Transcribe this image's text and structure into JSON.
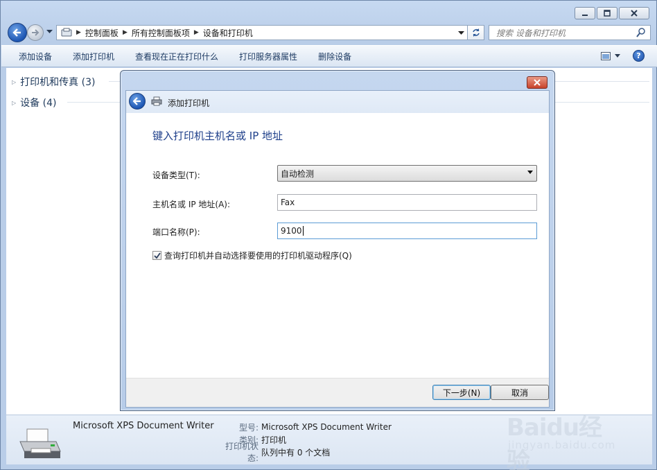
{
  "window": {
    "breadcrumbs": [
      "控制面板",
      "所有控制面板项",
      "设备和打印机"
    ],
    "search_placeholder": "搜索 设备和打印机"
  },
  "toolbar": {
    "items": [
      "添加设备",
      "添加打印机",
      "查看现在正在打印什么",
      "打印服务器属性",
      "删除设备"
    ]
  },
  "groups": [
    {
      "label": "打印机和传真 (3)"
    },
    {
      "label": "设备 (4)"
    }
  ],
  "details": {
    "name": "Microsoft XPS Document Writer",
    "rows": [
      {
        "key": "型号:",
        "value": "Microsoft XPS Document Writer"
      },
      {
        "key": "类别:",
        "value": "打印机"
      },
      {
        "key": "打印机状态:",
        "value": "队列中有 0 个文档"
      }
    ]
  },
  "dialog": {
    "title": "添加打印机",
    "heading": "键入打印机主机名或 IP 地址",
    "device_type_label": "设备类型(T):",
    "device_type_value": "自动检测",
    "host_label": "主机名或 IP 地址(A):",
    "host_value": "Fax",
    "port_label": "端口名称(P):",
    "port_value": "9100",
    "checkbox_label": "查询打印机并自动选择要使用的打印机驱动程序(Q)",
    "checkbox_checked": true,
    "next_button": "下一步(N)",
    "cancel_button": "取消"
  },
  "watermark": {
    "big": "Baidu经验",
    "small": "jingyan.baidu.com"
  },
  "colors": {
    "accent": "#1d56b3",
    "heading": "#1e3f8a",
    "close": "#c8432b"
  }
}
